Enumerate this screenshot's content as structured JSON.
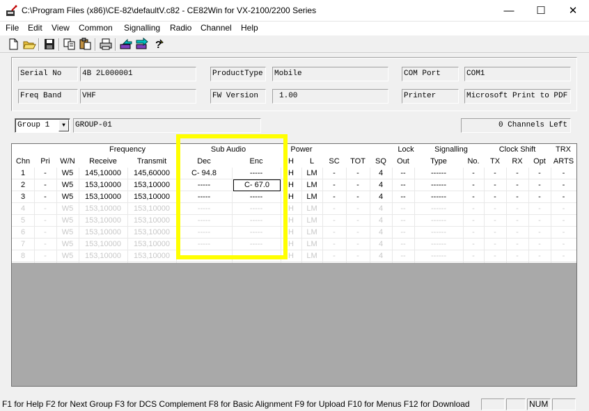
{
  "window": {
    "title": "C:\\Program Files (x86)\\CE-82\\defaultV.c82 - CE82Win for VX-2100/2200 Series",
    "minimize_glyph": "—",
    "maximize_glyph": "☐",
    "close_glyph": "✕"
  },
  "menu": [
    "File",
    "Edit",
    "View",
    "Common",
    "Signalling",
    "Radio",
    "Channel",
    "Help"
  ],
  "toolbar_icons": [
    "new-file-icon",
    "open-folder-icon",
    "save-icon",
    "copy-icon",
    "paste-icon",
    "print-icon",
    "upload-icon",
    "download-icon",
    "help-icon"
  ],
  "info": {
    "serial_label": "Serial No",
    "serial_value": "4B 2L000001",
    "product_label": "ProductType",
    "product_value": "Mobile",
    "com_label": "COM Port",
    "com_value": "COM1",
    "band_label": "Freq Band",
    "band_value": "VHF",
    "fw_label": "FW Version",
    "fw_value": "1.00",
    "printer_label": "Printer",
    "printer_value": "Microsoft Print to PDF"
  },
  "group": {
    "selected": "Group 1",
    "name": "GROUP-01",
    "channels_left": "0 Channels Left"
  },
  "grid": {
    "group_headers": {
      "frequency": "Frequency",
      "sub_audio": "Sub Audio",
      "power": "Power",
      "lock": "Lock",
      "signalling": "Signalling",
      "clock_shift": "Clock Shift",
      "trx": "TRX"
    },
    "columns": [
      "Chn",
      "Pri",
      "W/N",
      "Receive",
      "Transmit",
      "Dec",
      "Enc",
      "H",
      "L",
      "SC",
      "TOT",
      "SQ",
      "Out",
      "Type",
      "No.",
      "TX",
      "RX",
      "Opt",
      "ARTS"
    ],
    "rows": [
      [
        "1",
        "-",
        "W5",
        "145,10000",
        "145,60000",
        "C- 94.8",
        "-----",
        "H",
        "LM",
        "-",
        "-",
        "4",
        "--",
        "------",
        "-",
        "-",
        "-",
        "-",
        "-"
      ],
      [
        "2",
        "-",
        "W5",
        "153,10000",
        "153,10000",
        "-----",
        "C- 67.0",
        "H",
        "LM",
        "-",
        "-",
        "4",
        "--",
        "------",
        "-",
        "-",
        "-",
        "-",
        "-"
      ],
      [
        "3",
        "-",
        "W5",
        "153,10000",
        "153,10000",
        "-----",
        "-----",
        "H",
        "LM",
        "-",
        "-",
        "4",
        "--",
        "------",
        "-",
        "-",
        "-",
        "-",
        "-"
      ],
      [
        "4",
        "-",
        "W5",
        "153,10000",
        "153,10000",
        "-----",
        "-----",
        "H",
        "LM",
        "-",
        "-",
        "4",
        "--",
        "------",
        "-",
        "-",
        "-",
        "-",
        "-"
      ],
      [
        "5",
        "-",
        "W5",
        "153,10000",
        "153,10000",
        "-----",
        "-----",
        "H",
        "LM",
        "-",
        "-",
        "4",
        "--",
        "------",
        "-",
        "-",
        "-",
        "-",
        "-"
      ],
      [
        "6",
        "-",
        "W5",
        "153,10000",
        "153,10000",
        "-----",
        "-----",
        "H",
        "LM",
        "-",
        "-",
        "4",
        "--",
        "------",
        "-",
        "-",
        "-",
        "-",
        "-"
      ],
      [
        "7",
        "-",
        "W5",
        "153,10000",
        "153,10000",
        "-----",
        "-----",
        "H",
        "LM",
        "-",
        "-",
        "4",
        "--",
        "------",
        "-",
        "-",
        "-",
        "-",
        "-"
      ],
      [
        "8",
        "-",
        "W5",
        "153,10000",
        "153,10000",
        "-----",
        "-----",
        "H",
        "LM",
        "-",
        "-",
        "4",
        "--",
        "------",
        "-",
        "-",
        "-",
        "-",
        "-"
      ]
    ],
    "enabled_rows": 3
  },
  "status": {
    "help_text": "F1 for Help  F2 for Next Group  F3 for DCS Complement  F8 for Basic Alignment  F9 for Upload  F10 for Menus  F12 for Download",
    "num": "NUM"
  },
  "highlight_color": "#ffff00"
}
